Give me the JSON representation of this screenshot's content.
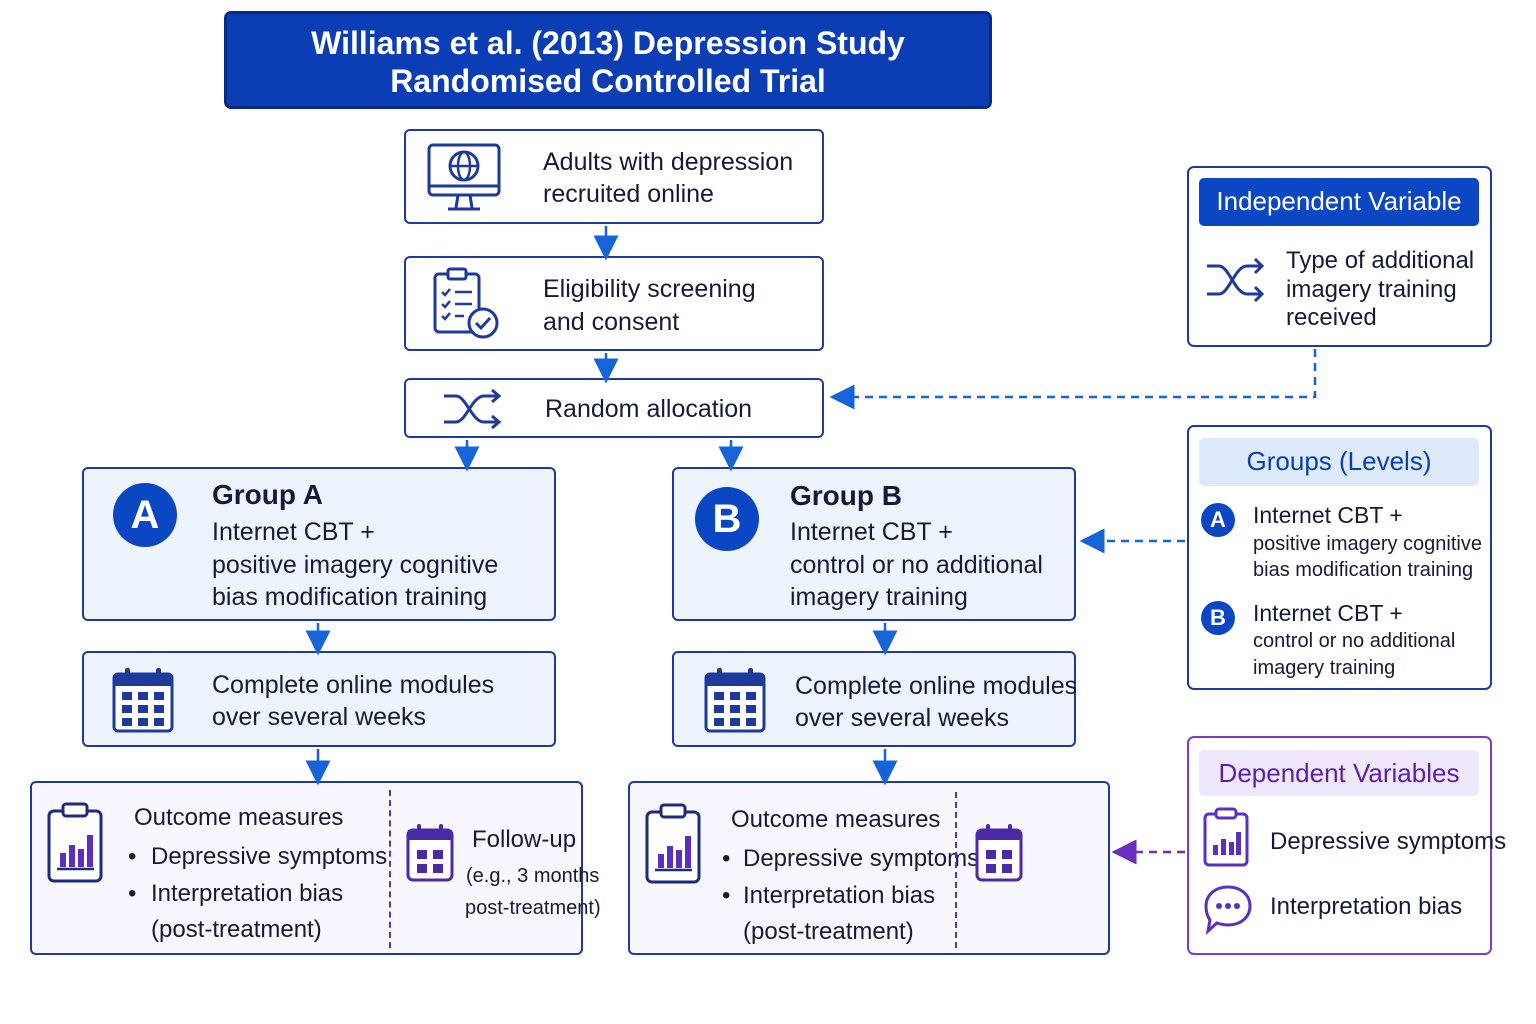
{
  "title": {
    "line1": "Williams et al. (2013) Depression Study",
    "line2": "Randomised Controlled Trial"
  },
  "flow": {
    "recruit": {
      "line1": "Adults with depression",
      "line2": "recruited online",
      "icon": "computer-globe-icon"
    },
    "screening": {
      "line1": "Eligibility screening",
      "line2": "and consent",
      "icon": "clipboard-check-icon"
    },
    "allocation": {
      "label": "Random allocation",
      "icon": "shuffle-icon"
    }
  },
  "groupA": {
    "badge": "A",
    "title": "Group A",
    "line1": "Internet CBT +",
    "line2": "positive imagery cognitive",
    "line3": "bias modification training",
    "modules": {
      "line1": "Complete online modules",
      "line2": "over several weeks"
    },
    "outcomes": {
      "title": "Outcome measures",
      "item1": "Depressive symptoms",
      "item2": "Interpretation bias",
      "item3": "(post-treatment)"
    },
    "followup": {
      "title": "Follow-up",
      "line1": "(e.g., 3 months",
      "line2": "post-treatment)"
    }
  },
  "groupB": {
    "badge": "B",
    "title": "Group B",
    "line1": "Internet CBT +",
    "line2": "control or no additional",
    "line3": "imagery training",
    "modules": {
      "line1": "Complete online modules",
      "line2": "over several weeks"
    },
    "outcomes": {
      "title": "Outcome measures",
      "item1": "Depressive symptoms",
      "item2": "Interpretation bias",
      "item3": "(post-treatment)"
    }
  },
  "independent": {
    "header": "Independent Variable",
    "line1": "Type of additional",
    "line2": "imagery training",
    "line3": "received"
  },
  "groups_levels": {
    "header": "Groups (Levels)",
    "a_badge": "A",
    "a_line1": "Internet CBT +",
    "a_line2": "positive imagery cognitive",
    "a_line3": "bias modification training",
    "b_badge": "B",
    "b_line1": "Internet CBT +",
    "b_line2": "control or no additional",
    "b_line3": "imagery training"
  },
  "dependent": {
    "header": "Dependent Variables",
    "item1": "Depressive symptoms",
    "item2": "Interpretation bias"
  },
  "colors": {
    "navy": "#1e3a9a",
    "blue": "#0b47c2",
    "purple": "#6a2ec0",
    "light_blue": "#eef4fd"
  }
}
